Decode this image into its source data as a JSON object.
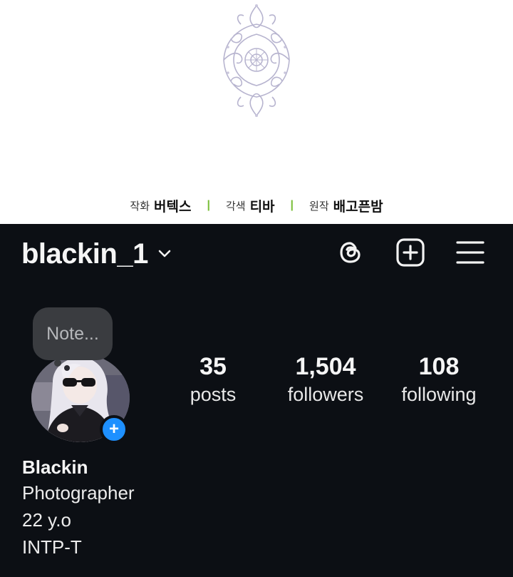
{
  "comic": {
    "credits": [
      {
        "role": "작화",
        "name": "버텍스"
      },
      {
        "role": "각색",
        "name": "티바"
      },
      {
        "role": "원작",
        "name": "배고픈밤"
      }
    ],
    "separator": "|",
    "accent_color": "#7bbf3a"
  },
  "profile": {
    "username": "blackin_1",
    "note_placeholder": "Note...",
    "add_story_glyph": "+",
    "stats": {
      "posts": {
        "value": "35",
        "label": "posts"
      },
      "followers": {
        "value": "1,504",
        "label": "followers"
      },
      "following": {
        "value": "108",
        "label": "following"
      }
    },
    "bio": {
      "name": "Blackin",
      "lines": [
        "Photographer",
        "22 y.o",
        "INTP-T"
      ]
    },
    "icons": [
      "chevron-down-icon",
      "threads-icon",
      "create-post-icon",
      "menu-icon"
    ],
    "background_color": "#0c0f14",
    "add_story_color": "#1e90ff"
  }
}
